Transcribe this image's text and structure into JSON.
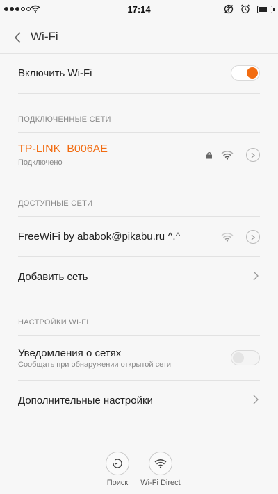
{
  "status_bar": {
    "time": "17:14",
    "signal_filled": 3,
    "signal_total": 5,
    "icons": [
      "wifi-icon",
      "data-off-icon",
      "alarm-clock-icon",
      "battery-icon"
    ],
    "battery_level": 0.7
  },
  "header": {
    "back_icon": "chevron-left-icon",
    "title": "Wi-Fi"
  },
  "wifi_toggle": {
    "label": "Включить Wi-Fi",
    "enabled": true
  },
  "connected_section": {
    "header": "ПОДКЛЮЧЕННЫЕ СЕТИ",
    "network": {
      "name": "TP-LINK_B006AE",
      "status": "Подключено",
      "secured": true
    }
  },
  "available_section": {
    "header": "ДОСТУПНЫЕ СЕТИ",
    "network": {
      "name": "FreeWiFi by ababok@pikabu.ru ^.^"
    },
    "add_network": "Добавить сеть"
  },
  "settings_section": {
    "header": "НАСТРОЙКИ WI-FI",
    "notifications": {
      "label": "Уведомления о сетях",
      "sublabel": "Сообщать при обнаружении открытой сети",
      "enabled": false
    },
    "advanced": "Дополнительные настройки"
  },
  "bottom_bar": {
    "search_label": "Поиск",
    "wifi_direct_label": "Wi-Fi Direct"
  },
  "colors": {
    "accent": "#f26c11",
    "background": "#f7f7f7"
  }
}
